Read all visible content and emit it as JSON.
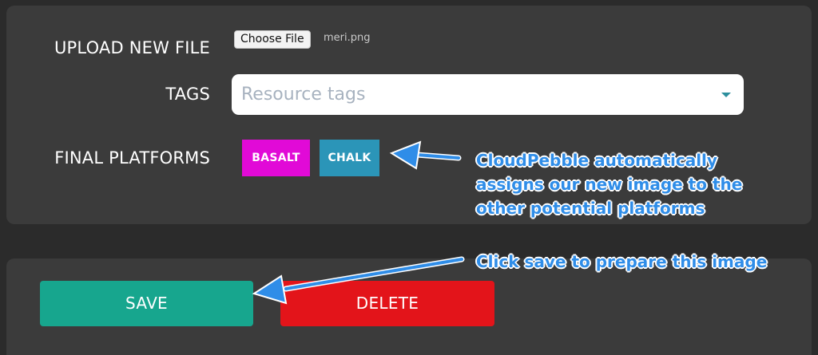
{
  "form": {
    "upload_label": "UPLOAD NEW FILE",
    "choose_file_label": "Choose File",
    "file_name": "meri.png",
    "tags_label": "TAGS",
    "tags_placeholder": "Resource tags",
    "platforms_label": "FINAL PLATFORMS",
    "platforms": [
      {
        "label": "BASALT",
        "color": "#e10ad7"
      },
      {
        "label": "CHALK",
        "color": "#2b95b8"
      }
    ]
  },
  "actions": {
    "save_label": "SAVE",
    "save_color": "#17a68e",
    "delete_label": "DELETE",
    "delete_color": "#e3141a"
  },
  "annotations": {
    "platforms_note": [
      "CloudPebble automatically",
      "assigns our new image to the",
      "other potential platforms"
    ],
    "save_note": "Click save to prepare this image",
    "arrow_color": "#2f8de8"
  }
}
